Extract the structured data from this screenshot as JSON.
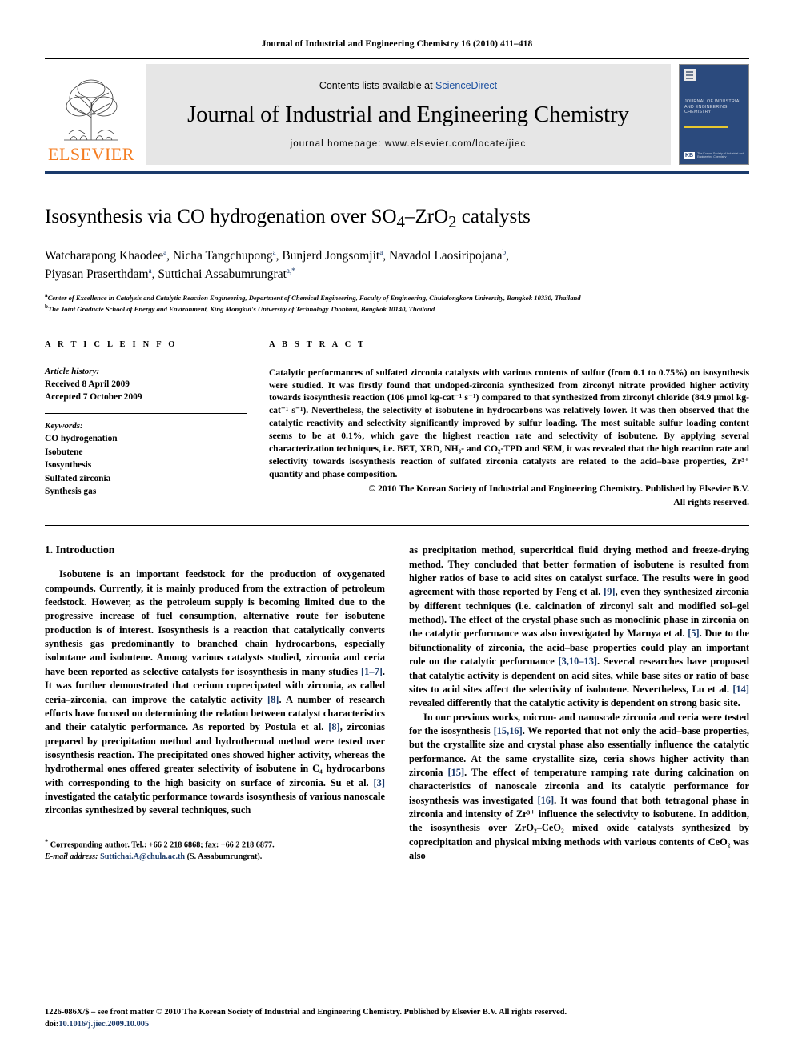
{
  "running_head": "Journal of Industrial and Engineering Chemistry 16 (2010) 411–418",
  "masthead": {
    "contents_prefix": "Contents lists available at ",
    "sciencedirect": "ScienceDirect",
    "journal_name": "Journal of Industrial and Engineering Chemistry",
    "homepage": "journal homepage: www.elsevier.com/locate/jiec",
    "publisher_logo_text": "ELSEVIER",
    "cover": {
      "title": "JOURNAL OF INDUSTRIAL AND ENGINEERING CHEMISTRY",
      "badge": "KB",
      "society": "The Korean Society of Industrial and Engineering Chemistry"
    },
    "accent_blue": "#1a4fa0",
    "elsevier_orange": "#F47C20",
    "rule_navy": "#1a3a6b"
  },
  "article": {
    "title_part1": "Isosynthesis via CO hydrogenation over SO",
    "title_sub1": "4",
    "title_dash": "–ZrO",
    "title_sub2": "2",
    "title_part2": " catalysts",
    "title_plain": "Isosynthesis via CO hydrogenation over SO4–ZrO2 catalysts",
    "authors": [
      {
        "name": "Watcharapong Khaodee",
        "mark": "a",
        "sep": ", "
      },
      {
        "name": "Nicha Tangchupong",
        "mark": "a",
        "sep": ", "
      },
      {
        "name": "Bunjerd Jongsomjit",
        "mark": "a",
        "sep": ", "
      },
      {
        "name": "Navadol Laosiripojana",
        "mark": "b",
        "sep": ","
      },
      {
        "name": "Piyasan Praserthdam",
        "mark": "a",
        "sep": ", "
      },
      {
        "name": "Suttichai Assabumrungrat",
        "mark": "a,*",
        "sep": ""
      }
    ],
    "affiliations": [
      {
        "mark": "a",
        "text": "Center of Excellence in Catalysis and Catalytic Reaction Engineering, Department of Chemical Engineering, Faculty of Engineering, Chulalongkorn University, Bangkok 10330, Thailand"
      },
      {
        "mark": "b",
        "text": "The Joint Graduate School of Energy and Environment, King Mongkut's University of Technology Thonburi, Bangkok 10140, Thailand"
      }
    ]
  },
  "article_info": {
    "heading": "A R T I C L E   I N F O",
    "history_label": "Article history:",
    "received": "Received 8 April 2009",
    "accepted": "Accepted 7 October 2009",
    "keywords_label": "Keywords:",
    "keywords": [
      "CO hydrogenation",
      "Isobutene",
      "Isosynthesis",
      "Sulfated zirconia",
      "Synthesis gas"
    ]
  },
  "abstract": {
    "heading": "A B S T R A C T",
    "text": "Catalytic performances of sulfated zirconia catalysts with various contents of sulfur (from 0.1 to 0.75%) on isosynthesis were studied. It was firstly found that undoped-zirconia synthesized from zirconyl nitrate provided higher activity towards isosynthesis reaction (106 μmol kg-cat⁻¹ s⁻¹) compared to that synthesized from zirconyl chloride (84.9 μmol kg-cat⁻¹ s⁻¹). Nevertheless, the selectivity of isobutene in hydrocarbons was relatively lower. It was then observed that the catalytic reactivity and selectivity significantly improved by sulfur loading. The most suitable sulfur loading content seems to be at 0.1%, which gave the highest reaction rate and selectivity of isobutene. By applying several characterization techniques, i.e. BET, XRD, NH₃- and CO₂-TPD and SEM, it was revealed that the high reaction rate and selectivity towards isosynthesis reaction of sulfated zirconia catalysts are related to the acid–base properties, Zr³⁺ quantity and phase composition.",
    "copyright_line1": "© 2010 The Korean Society of Industrial and Engineering Chemistry. Published by Elsevier B.V.",
    "copyright_line2": "All rights reserved."
  },
  "introduction": {
    "heading": "1. Introduction",
    "left_paragraphs": [
      "Isobutene is an important feedstock for the production of oxygenated compounds. Currently, it is mainly produced from the extraction of petroleum feedstock. However, as the petroleum supply is becoming limited due to the progressive increase of fuel consumption, alternative route for isobutene production is of interest. Isosynthesis is a reaction that catalytically converts synthesis gas predominantly to branched chain hydrocarbons, especially isobutane and isobutene. Among various catalysts studied, zirconia and ceria have been reported as selective catalysts for isosynthesis in many studies [1–7]. It was further demonstrated that cerium coprecipated with zirconia, as called ceria–zirconia, can improve the catalytic activity [8]. A number of research efforts have focused on determining the relation between catalyst characteristics and their catalytic performance. As reported by Postula et al. [8], zirconias prepared by precipitation method and hydrothermal method were tested over isosynthesis reaction. The precipitated ones showed higher activity, whereas the hydrothermal ones offered greater selectivity of isobutene in C₄ hydrocarbons with corresponding to the high basicity on surface of zirconia. Su et al. [3] investigated the catalytic performance towards isosynthesis of various nanoscale zirconias synthesized by several techniques, such"
    ],
    "right_paragraphs": [
      "as precipitation method, supercritical fluid drying method and freeze-drying method. They concluded that better formation of isobutene is resulted from higher ratios of base to acid sites on catalyst surface. The results were in good agreement with those reported by Feng et al. [9], even they synthesized zirconia by different techniques (i.e. calcination of zirconyl salt and modified sol–gel method). The effect of the crystal phase such as monoclinic phase in zirconia on the catalytic performance was also investigated by Maruya et al. [5]. Due to the bifunctionality of zirconia, the acid–base properties could play an important role on the catalytic performance [3,10–13]. Several researches have proposed that catalytic activity is dependent on acid sites, while base sites or ratio of base sites to acid sites affect the selectivity of isobutene. Nevertheless, Lu et al. [14] revealed differently that the catalytic activity is dependent on strong basic site.",
      "In our previous works, micron- and nanoscale zirconia and ceria were tested for the isosynthesis [15,16]. We reported that not only the acid–base properties, but the crystallite size and crystal phase also essentially influence the catalytic performance. At the same crystallite size, ceria shows higher activity than zirconia [15]. The effect of temperature ramping rate during calcination on characteristics of nanoscale zirconia and its catalytic performance for isosynthesis was investigated [16]. It was found that both tetragonal phase in zirconia and intensity of Zr³⁺ influence the selectivity to isobutene. In addition, the isosynthesis over ZrO₂–CeO₂ mixed oxide catalysts synthesized by coprecipitation and physical mixing methods with various contents of CeO₂ was also"
    ]
  },
  "footnote": {
    "star": "*",
    "corresponding": "Corresponding author. Tel.: +66 2 218 6868; fax: +66 2 218 6877.",
    "email_label": "E-mail address:",
    "email": "Suttichai.A@chula.ac.th",
    "email_owner": "(S. Assabumrungrat)."
  },
  "footer": {
    "line1": "1226-086X/$ – see front matter © 2010 The Korean Society of Industrial and Engineering Chemistry. Published by Elsevier B.V. All rights reserved.",
    "doi_label": "doi:",
    "doi": "10.1016/j.jiec.2009.10.005"
  }
}
